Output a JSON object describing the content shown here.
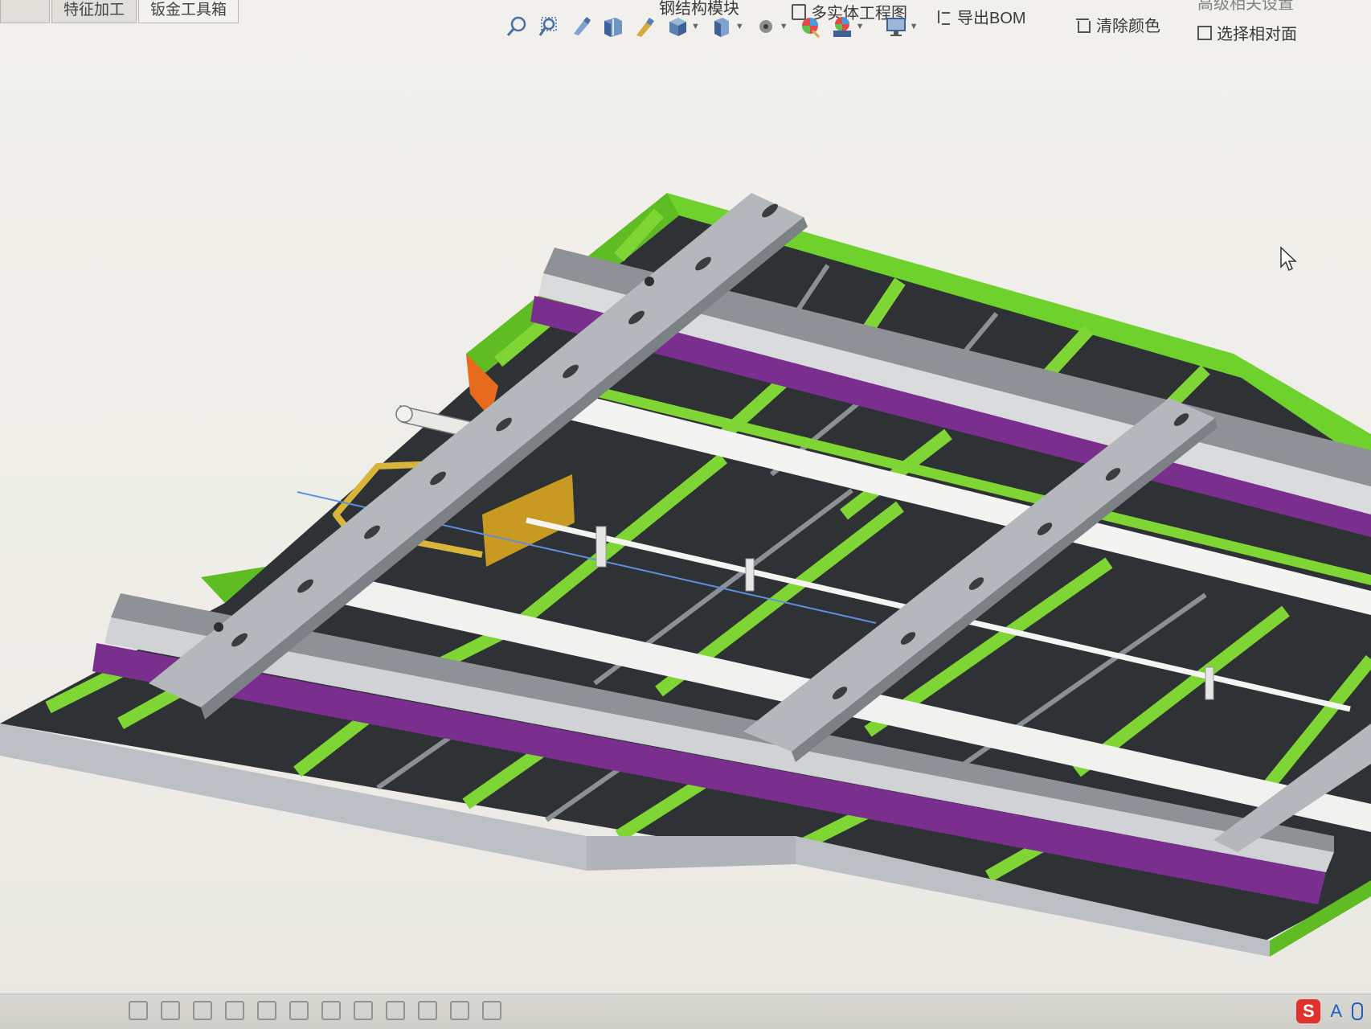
{
  "tabs": [
    {
      "label": "特征加工"
    },
    {
      "label": "钣金工具箱"
    }
  ],
  "commands": {
    "route": "钢结构模块",
    "multibody_drawing": "多实体工程图",
    "export_bom": "导出BOM",
    "clear_color": "清除颜色",
    "select_face": "选择相对面",
    "top_right": "高级相关设置"
  },
  "toolbar_icons": [
    "zoom-to-fit-icon",
    "zoom-area-icon",
    "previous-view-icon",
    "section-view-icon",
    "dynamic-annotation-icon",
    "view-orientation-icon",
    "display-style-icon",
    "hide-show-icon",
    "edit-appearance-icon",
    "apply-scene-icon",
    "view-settings-icon"
  ],
  "colors": {
    "frame_green": "#6fd12c",
    "beam_purple": "#7a2f8f",
    "rail_gray": "#b4b8bd",
    "deck_dark": "#2f3235",
    "handle_yellow": "#d8b43a",
    "corner_orange": "#e86a1e"
  },
  "ime": {
    "label": "S",
    "mode": "A"
  }
}
